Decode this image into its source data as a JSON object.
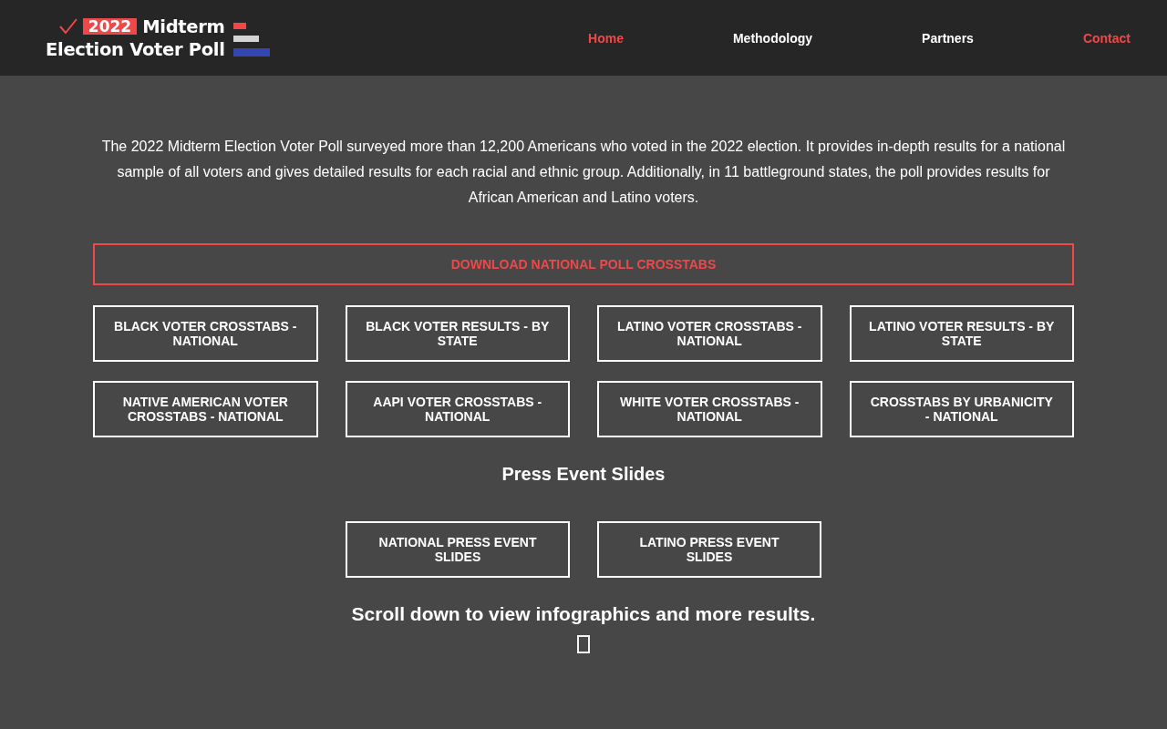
{
  "header": {
    "logo": {
      "badge": "2022",
      "title_line_1": "Midterm",
      "title_line_2": "Election Voter Poll"
    },
    "nav": [
      {
        "label": "Home",
        "color": "#f04848"
      },
      {
        "label": "Methodology",
        "color": "#ffffff"
      },
      {
        "label": "Partners",
        "color": "#ffffff"
      },
      {
        "label": "Contact",
        "color": "#f04848"
      }
    ]
  },
  "intro": "The 2022 Midterm Election Voter Poll surveyed more than 12,200 Americans who voted in the 2022 election. It provides in-depth results for a national sample of all voters and gives detailed results for each racial and ethnic group. Additionally, in 11 battleground states, the poll provides results for African American and Latino voters.",
  "primary_button": "DOWNLOAD NATIONAL POLL CROSSTABS",
  "crosstab_buttons": [
    "BLACK VOTER CROSSTABS - NATIONAL",
    "BLACK VOTER RESULTS - BY STATE",
    "LATINO VOTER CROSSTABS - NATIONAL",
    "LATINO VOTER RESULTS - BY STATE",
    "NATIVE AMERICAN VOTER CROSSTABS - NATIONAL",
    "AAPI VOTER CROSSTABS - NATIONAL",
    "WHITE VOTER CROSSTABS - NATIONAL",
    "CROSSTABS BY URBANICITY - NATIONAL"
  ],
  "press_section": {
    "heading": "Press Event Slides",
    "buttons": [
      "NATIONAL PRESS EVENT SLIDES",
      "LATINO PRESS EVENT SLIDES"
    ]
  },
  "scroll_hint": "Scroll down to view infographics and more results."
}
